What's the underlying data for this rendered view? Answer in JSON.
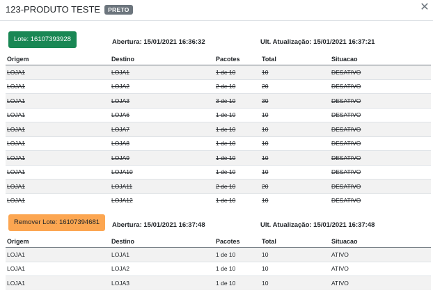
{
  "header": {
    "title": "123-PRODUTO TESTE",
    "badge": "PRETO",
    "close_icon": "close-icon"
  },
  "columns": [
    "Origem",
    "Destino",
    "Pacotes",
    "Total",
    "Situacao"
  ],
  "lote1": {
    "button_label": "Lote: 16107393928",
    "abertura": "Abertura: 15/01/2021 16:36:32",
    "atualizacao": "Ult. Atualização: 15/01/2021 16:37:21",
    "rows": [
      [
        "LOJA1",
        "LOJA1",
        "1 de 10",
        "10",
        "DESATIVO"
      ],
      [
        "LOJA1",
        "LOJA2",
        "2 de 10",
        "20",
        "DESATIVO"
      ],
      [
        "LOJA1",
        "LOJA3",
        "3 de 10",
        "30",
        "DESATIVO"
      ],
      [
        "LOJA1",
        "LOJA6",
        "1 de 10",
        "10",
        "DESATIVO"
      ],
      [
        "LOJA1",
        "LOJA7",
        "1 de 10",
        "10",
        "DESATIVO"
      ],
      [
        "LOJA1",
        "LOJA8",
        "1 de 10",
        "10",
        "DESATIVO"
      ],
      [
        "LOJA1",
        "LOJA9",
        "1 de 10",
        "10",
        "DESATIVO"
      ],
      [
        "LOJA1",
        "LOJA10",
        "1 de 10",
        "10",
        "DESATIVO"
      ],
      [
        "LOJA1",
        "LOJA11",
        "2 de 10",
        "20",
        "DESATIVO"
      ],
      [
        "LOJA1",
        "LOJA12",
        "1 de 10",
        "10",
        "DESATIVO"
      ]
    ]
  },
  "lote2": {
    "button_label": "Remover Lote: 16107394681",
    "abertura": "Abertura: 15/01/2021 16:37:48",
    "atualizacao": "Ult. Atualização: 15/01/2021 16:37:48",
    "rows": [
      [
        "LOJA1",
        "LOJA1",
        "1 de 10",
        "10",
        "ATIVO"
      ],
      [
        "LOJA1",
        "LOJA2",
        "1 de 10",
        "10",
        "ATIVO"
      ],
      [
        "LOJA1",
        "LOJA3",
        "1 de 10",
        "10",
        "ATIVO"
      ]
    ]
  },
  "colors": {
    "lote_button": "#198754",
    "remover_button": "#fca651",
    "badge": "#6c757d"
  }
}
